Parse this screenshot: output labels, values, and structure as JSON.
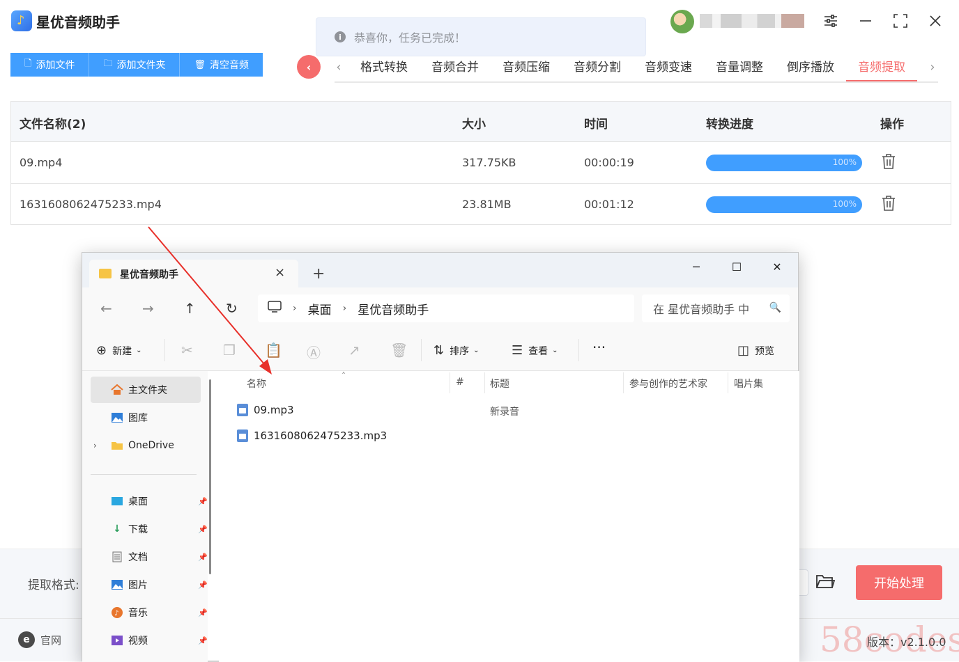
{
  "app": {
    "title": "星优音频助手",
    "toast": "恭喜你，任务已完成！"
  },
  "toolbar": {
    "add_file": "添加文件",
    "add_folder": "添加文件夹",
    "clear": "清空音频"
  },
  "tabs": [
    "格式转换",
    "音频合并",
    "音频压缩",
    "音频分割",
    "音频变速",
    "音量调整",
    "倒序播放",
    "音频提取"
  ],
  "active_tab": "音频提取",
  "table": {
    "headers": {
      "name": "文件名称(2)",
      "size": "大小",
      "time": "时间",
      "progress": "转换进度",
      "action": "操作"
    },
    "rows": [
      {
        "name": "09.mp4",
        "size": "317.75KB",
        "time": "00:00:19",
        "progress": 100,
        "progress_label": "100%"
      },
      {
        "name": "1631608062475233.mp4",
        "size": "23.81MB",
        "time": "00:01:12",
        "progress": 100,
        "progress_label": "100%"
      }
    ]
  },
  "bottom": {
    "extract_format_label": "提取格式:",
    "start_button": "开始处理",
    "website": "官网",
    "version": "版本：v2.1.0.0",
    "watermark": "58codes"
  },
  "explorer": {
    "tab_title": "星优音频助手",
    "address": [
      "桌面",
      "星优音频助手"
    ],
    "search_placeholder": "在 星优音频助手 中",
    "commands": {
      "new": "新建",
      "sort": "排序",
      "view": "查看",
      "preview": "预览"
    },
    "sidebar": [
      {
        "label": "主文件夹",
        "icon": "home-icon"
      },
      {
        "label": "图库",
        "icon": "gallery-icon"
      },
      {
        "label": "OneDrive",
        "icon": "folder-icon"
      },
      {
        "label": "桌面",
        "icon": "desktop-icon"
      },
      {
        "label": "下载",
        "icon": "download-icon"
      },
      {
        "label": "文档",
        "icon": "document-icon"
      },
      {
        "label": "图片",
        "icon": "picture-icon"
      },
      {
        "label": "音乐",
        "icon": "music-icon"
      },
      {
        "label": "视频",
        "icon": "video-icon"
      }
    ],
    "columns": {
      "name": "名称",
      "number": "#",
      "title": "标题",
      "artists": "参与创作的艺术家",
      "album": "唱片集"
    },
    "files": [
      {
        "name": "09.mp3",
        "title": "新录音"
      },
      {
        "name": "1631608062475233.mp3",
        "title": ""
      }
    ]
  },
  "colors": {
    "primary": "#409eff",
    "accent_red": "#f56c6c",
    "arrow": "#e8302a"
  }
}
